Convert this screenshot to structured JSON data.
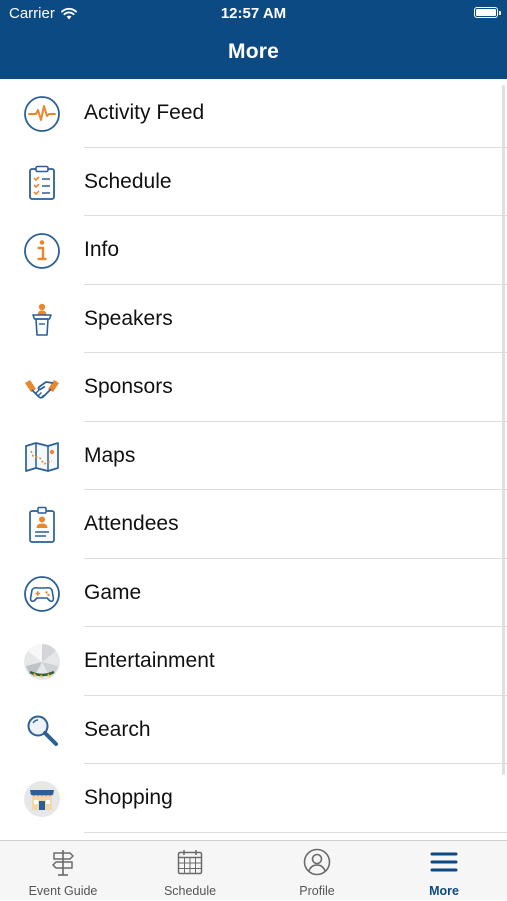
{
  "status_bar": {
    "carrier": "Carrier",
    "time": "12:57 AM"
  },
  "nav": {
    "title": "More"
  },
  "menu": [
    {
      "label": "Activity Feed",
      "icon": "activity-icon"
    },
    {
      "label": "Schedule",
      "icon": "clipboard-list-icon"
    },
    {
      "label": "Info",
      "icon": "info-icon"
    },
    {
      "label": "Speakers",
      "icon": "podium-speaker-icon"
    },
    {
      "label": "Sponsors",
      "icon": "handshake-icon"
    },
    {
      "label": "Maps",
      "icon": "folded-map-icon"
    },
    {
      "label": "Attendees",
      "icon": "id-badge-icon"
    },
    {
      "label": "Game",
      "icon": "gamepad-icon"
    },
    {
      "label": "Entertainment",
      "icon": "entertainment-icon"
    },
    {
      "label": "Search",
      "icon": "magnifier-icon"
    },
    {
      "label": "Shopping",
      "icon": "storefront-icon"
    }
  ],
  "tabs": [
    {
      "label": "Event Guide",
      "icon": "signpost-icon",
      "active": false
    },
    {
      "label": "Schedule",
      "icon": "calendar-icon",
      "active": false
    },
    {
      "label": "Profile",
      "icon": "user-circle-icon",
      "active": false
    },
    {
      "label": "More",
      "icon": "hamburger-menu-icon",
      "active": true
    }
  ],
  "colors": {
    "header": "#0c4a84",
    "icon_blue": "#2b5f98",
    "icon_orange": "#e8872b",
    "tab_active": "#0c4a84",
    "tab_inactive": "#6b6b6b"
  }
}
